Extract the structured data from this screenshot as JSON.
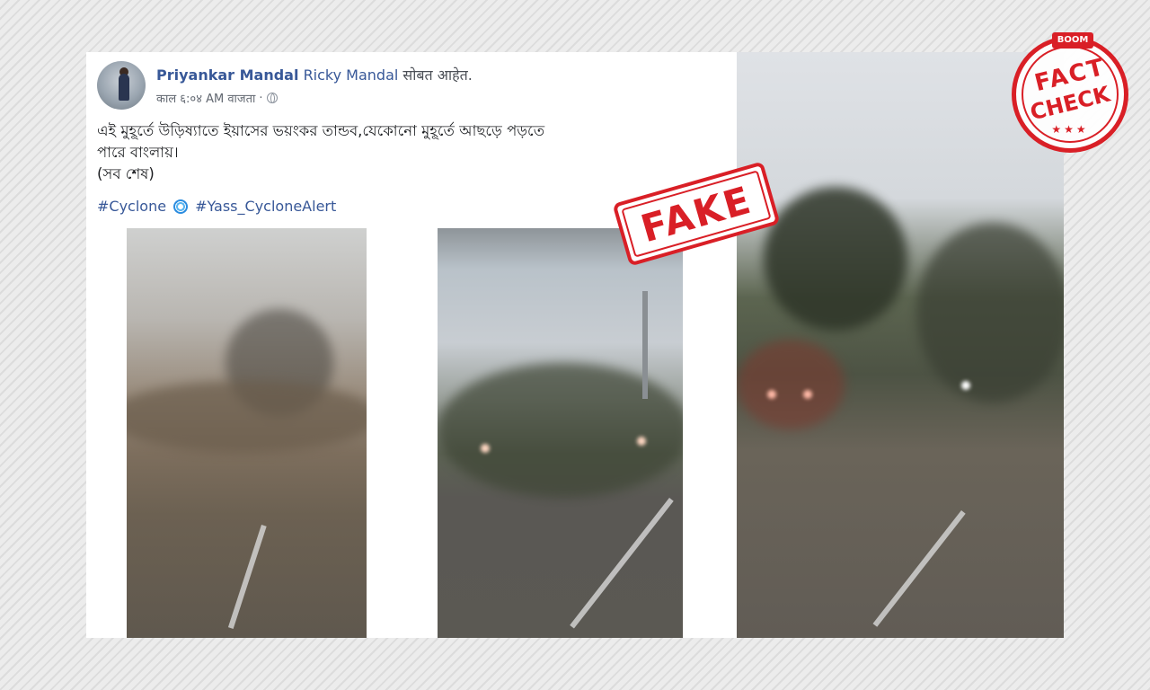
{
  "post": {
    "author": "Priyankar Mandal",
    "tagged_user": "Ricky Mandal",
    "with_text": "सोबत आहेत.",
    "time": "काल ६:०४ AM वाजता",
    "separator": "·",
    "text_line1": "এই মুহূর্তে উড়িষ্যাতে ইয়াসের ভয়ংকর তান্ডব,যেকোনো মুহূর্তে আছড়ে পড়তে",
    "text_line2": "পারে বাংলায়।",
    "text_line3": "(সব শেষ)",
    "hashtags": [
      "#Cyclone",
      "#Yass_CycloneAlert"
    ]
  },
  "overlay": {
    "fake_stamp": "FAKE",
    "badge_brand": "BOOM",
    "badge_line1": "FACT",
    "badge_line2": "CHECK",
    "badge_stars": "★★★"
  },
  "icons": {
    "globe": "globe-icon",
    "cyclone": "cyclone-icon"
  },
  "colors": {
    "link": "#385898",
    "stamp_red": "#d91f26"
  }
}
